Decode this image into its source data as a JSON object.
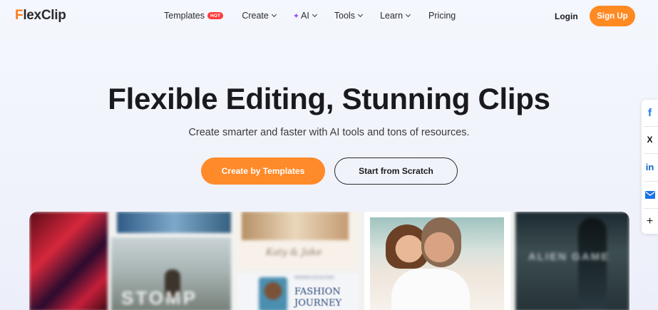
{
  "brand": {
    "logo_initial": "F",
    "logo_rest": "lexClip"
  },
  "nav": {
    "templates": "Templates",
    "hot_badge": "HOT",
    "create": "Create",
    "ai_spark": "✦",
    "ai": "AI",
    "tools": "Tools",
    "learn": "Learn",
    "pricing": "Pricing"
  },
  "auth": {
    "login": "Login",
    "signup": "Sign Up"
  },
  "hero": {
    "title": "Flexible Editing, Stunning Clips",
    "subtitle": "Create smarter and faster with AI tools and tons of resources.",
    "primary_cta": "Create by Templates",
    "secondary_cta": "Start from Scratch"
  },
  "share": {
    "facebook": "f",
    "x": "X",
    "linkedin": "in",
    "more": "+"
  },
  "showcase": {
    "tile_stomp": "STOMP",
    "tile_script": "Katy & Jake",
    "tile_fashion_small": "FASHION COLLECTION",
    "tile_fashion_1": "FASHION",
    "tile_fashion_2": "JOURNEY",
    "tile_alien": "ALIEN GAME"
  },
  "colors": {
    "accent": "#ff8a22",
    "hot": "#ff3b3b",
    "ai": "#9b4dff",
    "facebook": "#1877f2",
    "linkedin": "#0a66c2",
    "mail": "#1a73e8"
  }
}
